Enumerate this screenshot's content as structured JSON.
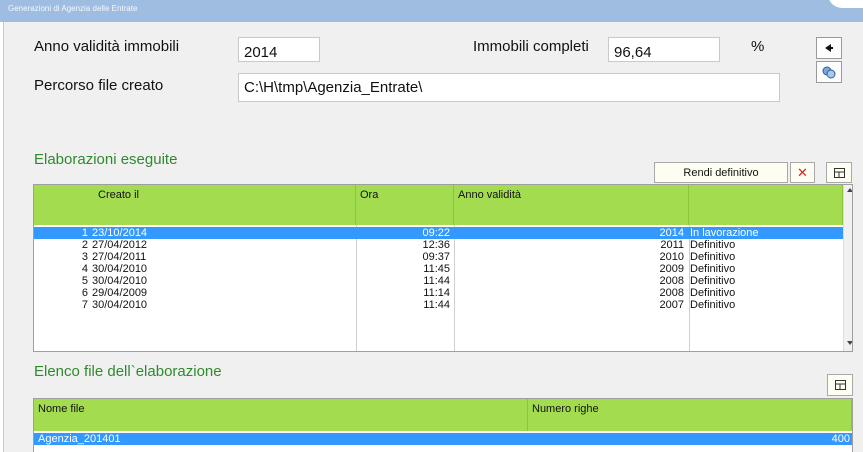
{
  "window": {
    "title": "Generazioni di Agenzia delle Entrate"
  },
  "header": {
    "anno_label": "Anno validità immobili",
    "anno_value": "2014",
    "completi_label": "Immobili completi",
    "completi_value": "96,64",
    "percent": "%",
    "percorso_label": "Percorso file creato",
    "percorso_value": "C:\\H\\tmp\\Agenzia_Entrate\\"
  },
  "elaborazioni": {
    "title": "Elaborazioni eseguite",
    "rendi_label": "Rendi definitivo",
    "delete_glyph": "✕",
    "columns": [
      "Creato il",
      "Ora",
      "Anno validità",
      ""
    ],
    "rows": [
      {
        "n": "1",
        "date": "23/10/2014",
        "time": "09:22",
        "anno": "2014",
        "stato": "In lavorazione"
      },
      {
        "n": "2",
        "date": "27/04/2012",
        "time": "12:36",
        "anno": "2011",
        "stato": "Definitivo"
      },
      {
        "n": "3",
        "date": "27/04/2011",
        "time": "09:37",
        "anno": "2010",
        "stato": "Definitivo"
      },
      {
        "n": "4",
        "date": "30/04/2010",
        "time": "11:45",
        "anno": "2009",
        "stato": "Definitivo"
      },
      {
        "n": "5",
        "date": "30/04/2010",
        "time": "11:44",
        "anno": "2008",
        "stato": "Definitivo"
      },
      {
        "n": "6",
        "date": "29/04/2009",
        "time": "11:14",
        "anno": "2008",
        "stato": "Definitivo"
      },
      {
        "n": "7",
        "date": "30/04/2010",
        "time": "11:44",
        "anno": "2007",
        "stato": "Definitivo"
      }
    ]
  },
  "files": {
    "title": "Elenco file dell`elaborazione",
    "columns": [
      "Nome file",
      "Numero righe"
    ],
    "rows": [
      {
        "name": "Agenzia_201401",
        "righe": "400"
      }
    ]
  },
  "colors": {
    "accent_green": "#a4dc4f",
    "selection": "#3399ff",
    "section_title": "#2f8a2f"
  }
}
